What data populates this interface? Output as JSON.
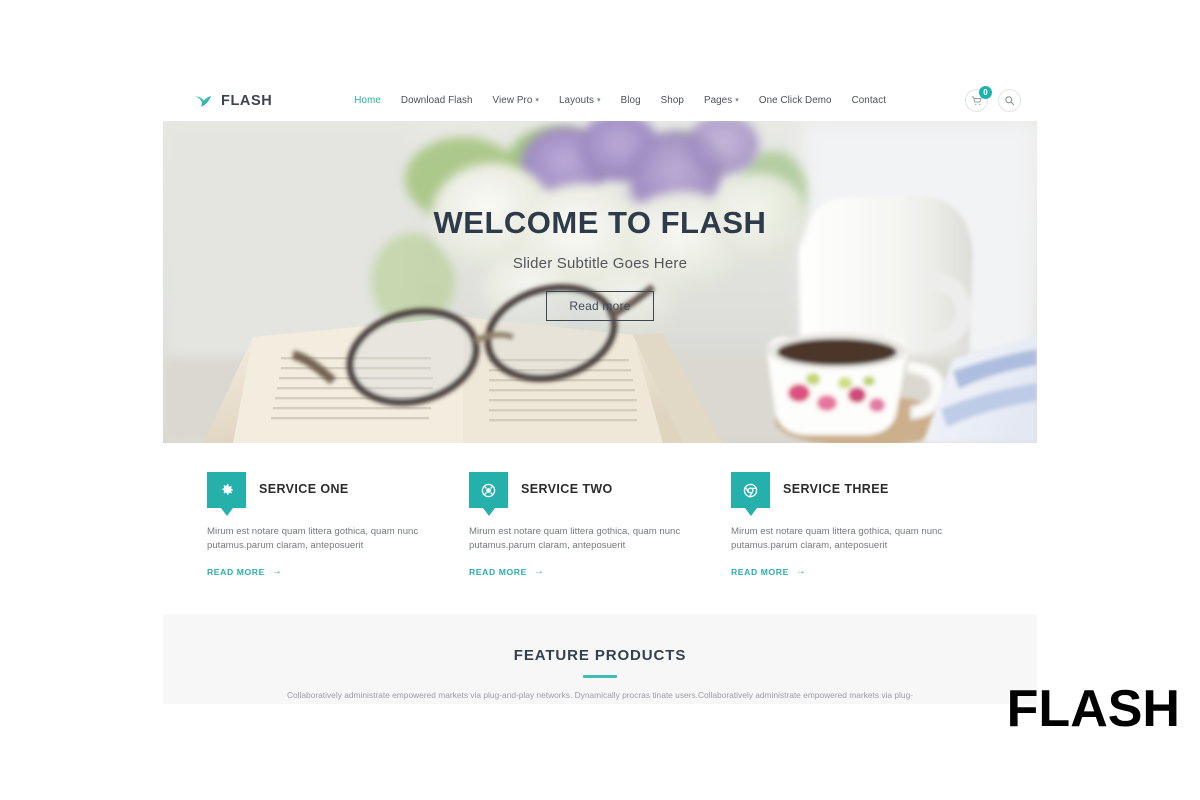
{
  "brand": {
    "name": "FLASH",
    "logo_icon": "flash-bird-logo-icon",
    "accent_color": "#26b0ac"
  },
  "header": {
    "nav": [
      {
        "label": "Home",
        "active": true,
        "has_caret": false
      },
      {
        "label": "Download Flash",
        "active": false,
        "has_caret": false
      },
      {
        "label": "View Pro",
        "active": false,
        "has_caret": true
      },
      {
        "label": "Layouts",
        "active": false,
        "has_caret": true
      },
      {
        "label": "Blog",
        "active": false,
        "has_caret": false
      },
      {
        "label": "Shop",
        "active": false,
        "has_caret": false
      },
      {
        "label": "Pages",
        "active": false,
        "has_caret": true
      },
      {
        "label": "One Click Demo",
        "active": false,
        "has_caret": false
      },
      {
        "label": "Contact",
        "active": false,
        "has_caret": false
      }
    ],
    "cart": {
      "icon": "shopping-cart-icon",
      "count": "0",
      "badge_color": "#20b2aa"
    },
    "search": {
      "icon": "search-icon"
    }
  },
  "hero": {
    "title": "WELCOME TO FLASH",
    "subtitle": "Slider Subtitle Goes Here",
    "button_label": "Read more",
    "image_description": "Lilac bouquet in white pitcher, eyeglasses on open book, floral coffee cup"
  },
  "services": [
    {
      "icon": "gear-icon",
      "title": "SERVICE ONE",
      "description": "Mirum est notare quam littera gothica, quam nunc putamus.parum claram, anteposuerit",
      "link_label": "READ MORE",
      "link_arrow": "→"
    },
    {
      "icon": "lifebuoy-icon",
      "title": "SERVICE TWO",
      "description": "Mirum est notare quam littera gothica, quam nunc putamus.parum claram, anteposuerit",
      "link_label": "READ MORE",
      "link_arrow": "→"
    },
    {
      "icon": "chrome-icon",
      "title": "SERVICE THREE",
      "description": "Mirum est notare quam littera gothica, quam nunc putamus.parum claram, anteposuerit",
      "link_label": "READ MORE",
      "link_arrow": "→"
    }
  ],
  "feature_section": {
    "title": "FEATURE PRODUCTS",
    "description": "Collaboratively administrate empowered markets via plug-and-play networks. Dynamically procras tinate users.Collaboratively administrate empowered markets via plug-"
  },
  "overlay": {
    "word": "FLASH"
  }
}
